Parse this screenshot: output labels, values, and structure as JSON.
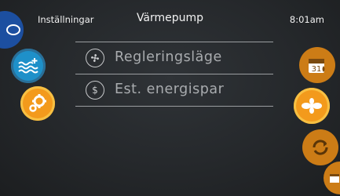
{
  "header": {
    "left_label": "Inställningar",
    "title": "Värmepump",
    "time": "8:01am"
  },
  "left_icons": [
    {
      "name": "partial-blue-icon"
    },
    {
      "name": "water-heat-icon"
    },
    {
      "name": "settings-gears-icon"
    }
  ],
  "menu": {
    "items": [
      {
        "label": "Regleringsläge",
        "icon": "fan-icon"
      },
      {
        "label": "Est. energispar",
        "icon": "energy-savings-icon"
      }
    ]
  },
  "right_icons": [
    {
      "name": "calendar-schedule-icon",
      "calendar_number": "31"
    },
    {
      "name": "fan-icon-selected"
    },
    {
      "name": "cycle-arrows-icon"
    },
    {
      "name": "partial-orange-icon"
    }
  ],
  "colors": {
    "background": "#2a2d30",
    "accent_orange": "#f39a1c",
    "accent_blue": "#1e90c9",
    "menu_text": "#a9acaf"
  }
}
